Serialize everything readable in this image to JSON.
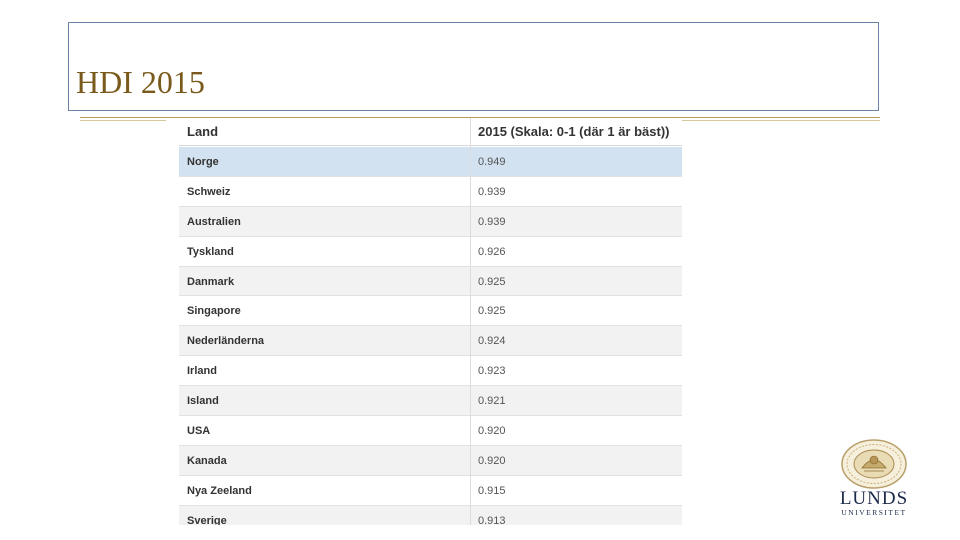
{
  "slide": {
    "title": "HDI 2015"
  },
  "table": {
    "headers": [
      "Land",
      "2015 (Skala: 0-1 (där 1 är bäst))"
    ],
    "rows": [
      {
        "land": "Norge",
        "value": "0.949"
      },
      {
        "land": "Schweiz",
        "value": "0.939"
      },
      {
        "land": "Australien",
        "value": "0.939"
      },
      {
        "land": "Tyskland",
        "value": "0.926"
      },
      {
        "land": "Danmark",
        "value": "0.925"
      },
      {
        "land": "Singapore",
        "value": "0.925"
      },
      {
        "land": "Nederländerna",
        "value": "0.924"
      },
      {
        "land": "Irland",
        "value": "0.923"
      },
      {
        "land": "Island",
        "value": "0.921"
      },
      {
        "land": "USA",
        "value": "0.920"
      },
      {
        "land": "Kanada",
        "value": "0.920"
      },
      {
        "land": "Nya Zeeland",
        "value": "0.915"
      },
      {
        "land": "Sverige",
        "value": "0.913"
      }
    ],
    "highlighted_row": 0
  },
  "logo": {
    "name": "LUNDS",
    "subtitle": "UNIVERSITET"
  },
  "colors": {
    "title": "#7a5a1c",
    "highlight": "#d3e2f0",
    "stripe": "#f2f2f2"
  }
}
